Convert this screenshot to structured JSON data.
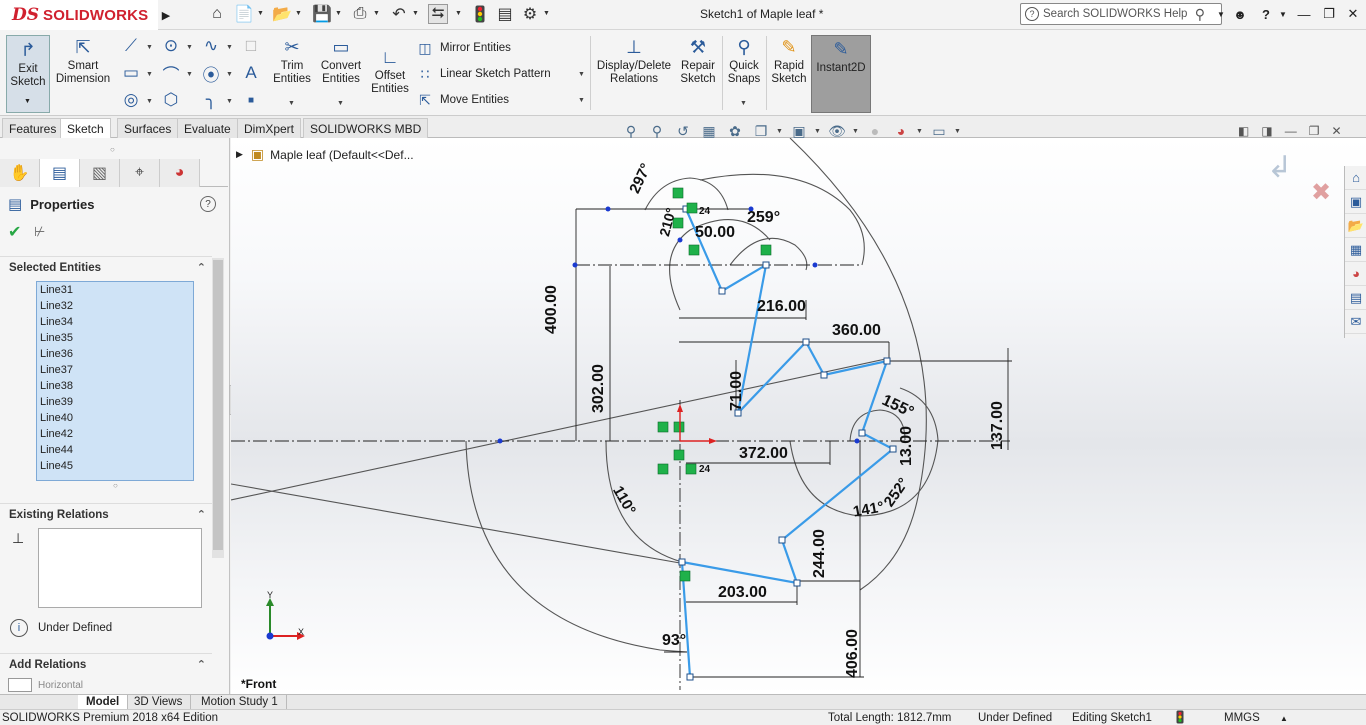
{
  "app": {
    "brand": "SOLIDWORKS",
    "ds_mark": "DS",
    "doc_title": "Sketch1 of Maple leaf *"
  },
  "search": {
    "placeholder": "Search SOLIDWORKS Help"
  },
  "quick_access": [
    "home-icon",
    "new-document-icon",
    "open-folder-icon",
    "save-icon",
    "print-icon",
    "undo-icon",
    "select-cursor-icon",
    "traffic-light-icon",
    "file-properties-icon",
    "options-gear-icon"
  ],
  "cmd": {
    "exit_sketch": "Exit Sketch",
    "smart_dimension": "Smart Dimension",
    "trim_entities": "Trim Entities",
    "convert_entities": "Convert Entities",
    "offset_entities": "Offset Entities",
    "mirror_entities": "Mirror Entities",
    "linear_pattern": "Linear Sketch Pattern",
    "move_entities": "Move Entities",
    "display_relations": "Display/Delete Relations",
    "repair_sketch": "Repair Sketch",
    "quick_snaps": "Quick Snaps",
    "rapid_sketch": "Rapid Sketch",
    "instant2d": "Instant2D"
  },
  "tabs": [
    "Features",
    "Sketch",
    "Surfaces",
    "Evaluate",
    "DimXpert",
    "SOLIDWORKS MBD"
  ],
  "active_tab": "Sketch",
  "panel": {
    "title": "Properties",
    "selected_entities": "Selected Entities",
    "entities": [
      "Line31",
      "Line32",
      "Line34",
      "Line35",
      "Line36",
      "Line37",
      "Line38",
      "Line39",
      "Line40",
      "Line42",
      "Line44",
      "Line45"
    ],
    "existing_relations": "Existing Relations",
    "status": "Under Defined",
    "add_relations": "Add Relations",
    "horizontal_hint": "Horizontal"
  },
  "tree": {
    "root": "Maple leaf  (Default<<Def..."
  },
  "view_label": "*Front",
  "triad": {
    "x": "X",
    "y": "Y"
  },
  "dimensions": {
    "d297": "297°",
    "d210": "210°",
    "d24a": "24",
    "d259": "259°",
    "d50": "50.00",
    "d216": "216.00",
    "d360": "360.00",
    "d400": "400.00",
    "d302": "302.00",
    "d71": "71.00",
    "d155": "155°",
    "d137": "137.00",
    "d13": "13.00",
    "d372": "372.00",
    "d24b": "24",
    "d110": "110°",
    "d252": "252°",
    "d141": "141°",
    "d244": "244.00",
    "d203": "203.00",
    "d93": "93°",
    "d406": "406.00"
  },
  "bottom_tabs": [
    "Model",
    "3D Views",
    "Motion Study 1"
  ],
  "status": {
    "edition": "SOLIDWORKS Premium 2018 x64 Edition",
    "total_length": "Total Length: 1812.7mm",
    "defined": "Under Defined",
    "editing": "Editing Sketch1",
    "units": "MMGS"
  },
  "colors": {
    "brand_red": "#d0202e",
    "sketch_blue": "#3a9be8",
    "relation_green": "#1fb14a",
    "instant2d_bg": "#9e9e9e"
  }
}
